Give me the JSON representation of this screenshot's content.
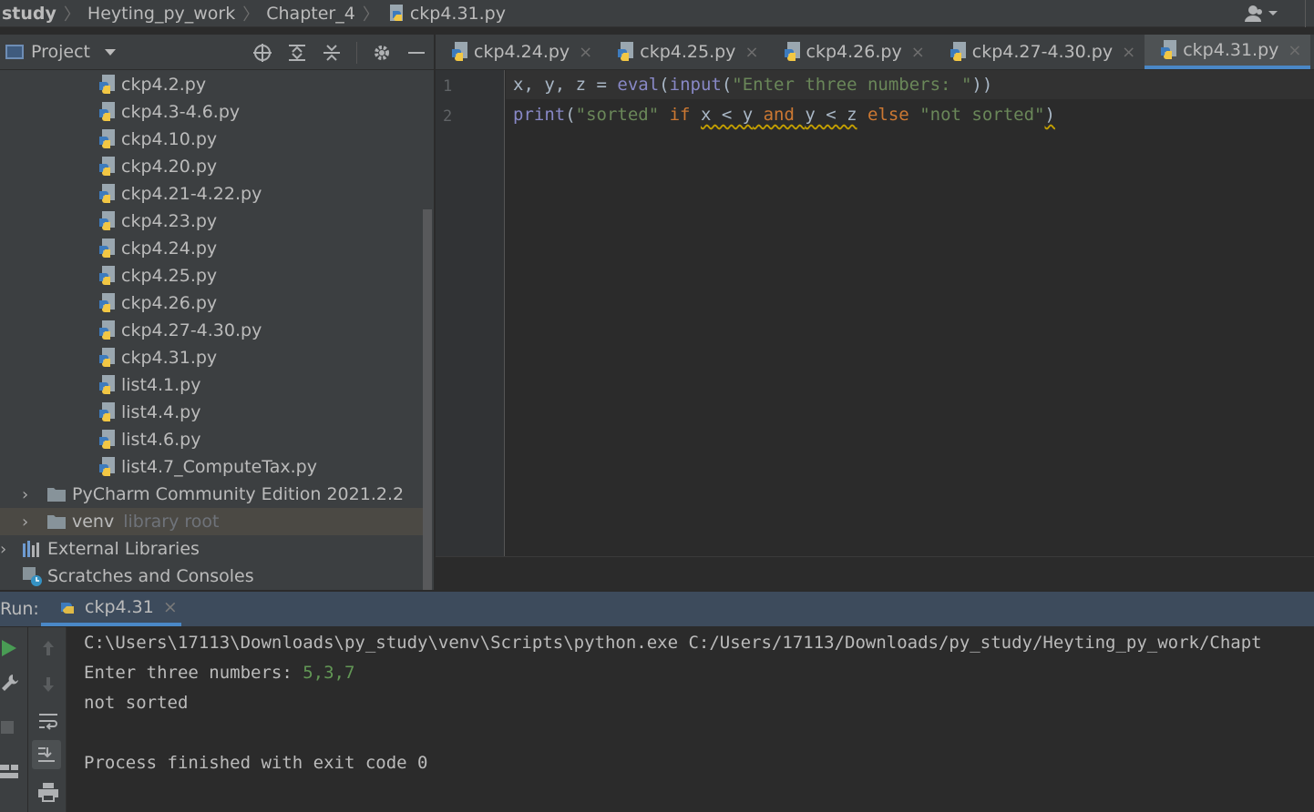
{
  "breadcrumb": {
    "items": [
      "study",
      "Heyting_py_work",
      "Chapter_4",
      "ckp4.31.py"
    ]
  },
  "project_panel": {
    "title": "Project",
    "tree": [
      {
        "label": "ckp4.2.py",
        "type": "py"
      },
      {
        "label": "ckp4.3-4.6.py",
        "type": "py"
      },
      {
        "label": "ckp4.10.py",
        "type": "py"
      },
      {
        "label": "ckp4.20.py",
        "type": "py"
      },
      {
        "label": "ckp4.21-4.22.py",
        "type": "py"
      },
      {
        "label": "ckp4.23.py",
        "type": "py"
      },
      {
        "label": "ckp4.24.py",
        "type": "py"
      },
      {
        "label": "ckp4.25.py",
        "type": "py"
      },
      {
        "label": "ckp4.26.py",
        "type": "py"
      },
      {
        "label": "ckp4.27-4.30.py",
        "type": "py"
      },
      {
        "label": "ckp4.31.py",
        "type": "py"
      },
      {
        "label": "list4.1.py",
        "type": "py"
      },
      {
        "label": "list4.4.py",
        "type": "py"
      },
      {
        "label": "list4.6.py",
        "type": "py"
      },
      {
        "label": "list4.7_ComputeTax.py",
        "type": "py"
      }
    ],
    "folders": {
      "pycharm": "PyCharm Community Edition 2021.2.2",
      "venv": "venv",
      "venv_note": "library root",
      "external": "External Libraries",
      "scratches": "Scratches and Consoles"
    }
  },
  "editor": {
    "tabs": [
      {
        "label": "ckp4.24.py",
        "active": false
      },
      {
        "label": "ckp4.25.py",
        "active": false
      },
      {
        "label": "ckp4.26.py",
        "active": false
      },
      {
        "label": "ckp4.27-4.30.py",
        "active": false
      },
      {
        "label": "ckp4.31.py",
        "active": true
      }
    ],
    "line_numbers": [
      "1",
      "2"
    ],
    "line1": {
      "vars": "x, y, z",
      "eq": " = ",
      "fn1": "eval",
      "p1": "(",
      "fn2": "input",
      "p2": "(",
      "str": "\"Enter three numbers: \"",
      "p3": "))"
    },
    "line2": {
      "fn": "print",
      "p1": "(",
      "str1": "\"sorted\"",
      "kw_if": " if ",
      "cond1": "x < y",
      "kw_and": " and ",
      "cond2": "y < z",
      "kw_else": " else ",
      "str2": "\"not sorted\"",
      "p2": ")"
    }
  },
  "run": {
    "label": "Run:",
    "tab": "ckp4.31",
    "console": {
      "line1": "C:\\Users\\17113\\Downloads\\py_study\\venv\\Scripts\\python.exe C:/Users/17113/Downloads/py_study/Heyting_py_work/Chapt",
      "line2_prompt": "Enter three numbers: ",
      "line2_input": "5,3,7",
      "line3": "not sorted",
      "line4": "",
      "line5": "Process finished with exit code 0"
    }
  },
  "colors": {
    "accent": "#4a88c7",
    "panel_bg": "#3c3f41",
    "editor_bg": "#2b2b2b",
    "keyword": "#cc7832",
    "string": "#6a8759",
    "builtin": "#8888c6"
  }
}
